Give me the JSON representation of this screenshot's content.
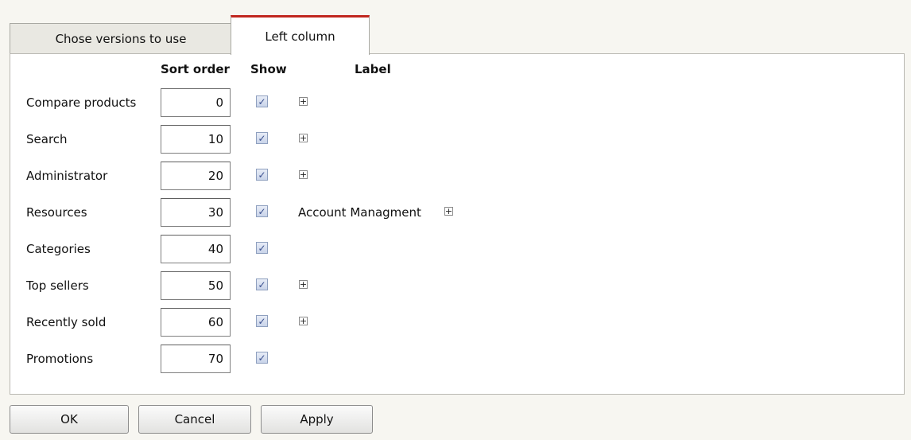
{
  "tabs": [
    {
      "label": "Chose versions to use",
      "active": false
    },
    {
      "label": "Left column",
      "active": true
    }
  ],
  "headers": {
    "sort_order": "Sort order",
    "show": "Show",
    "label": "Label"
  },
  "rows": [
    {
      "name": "Compare products",
      "sort": "0",
      "show": true,
      "label": "",
      "expand_icon": "plus-box-icon"
    },
    {
      "name": "Search",
      "sort": "10",
      "show": true,
      "label": "",
      "expand_icon": "plus-box-icon"
    },
    {
      "name": "Administrator",
      "sort": "20",
      "show": true,
      "label": "",
      "expand_icon": "plus-box-icon"
    },
    {
      "name": "Resources",
      "sort": "30",
      "show": true,
      "label": "Account Managment",
      "expand_icon": "plus-box-icon"
    },
    {
      "name": "Categories",
      "sort": "40",
      "show": true,
      "label": "",
      "expand_icon": ""
    },
    {
      "name": "Top sellers",
      "sort": "50",
      "show": true,
      "label": "",
      "expand_icon": "plus-box-icon"
    },
    {
      "name": "Recently sold",
      "sort": "60",
      "show": true,
      "label": "",
      "expand_icon": "plus-box-icon"
    },
    {
      "name": "Promotions",
      "sort": "70",
      "show": true,
      "label": "",
      "expand_icon": ""
    }
  ],
  "buttons": {
    "ok": "OK",
    "cancel": "Cancel",
    "apply": "Apply"
  },
  "colors": {
    "active_tab_accent": "#c0271f",
    "background": "#f7f6f1",
    "panel": "#ffffff"
  }
}
